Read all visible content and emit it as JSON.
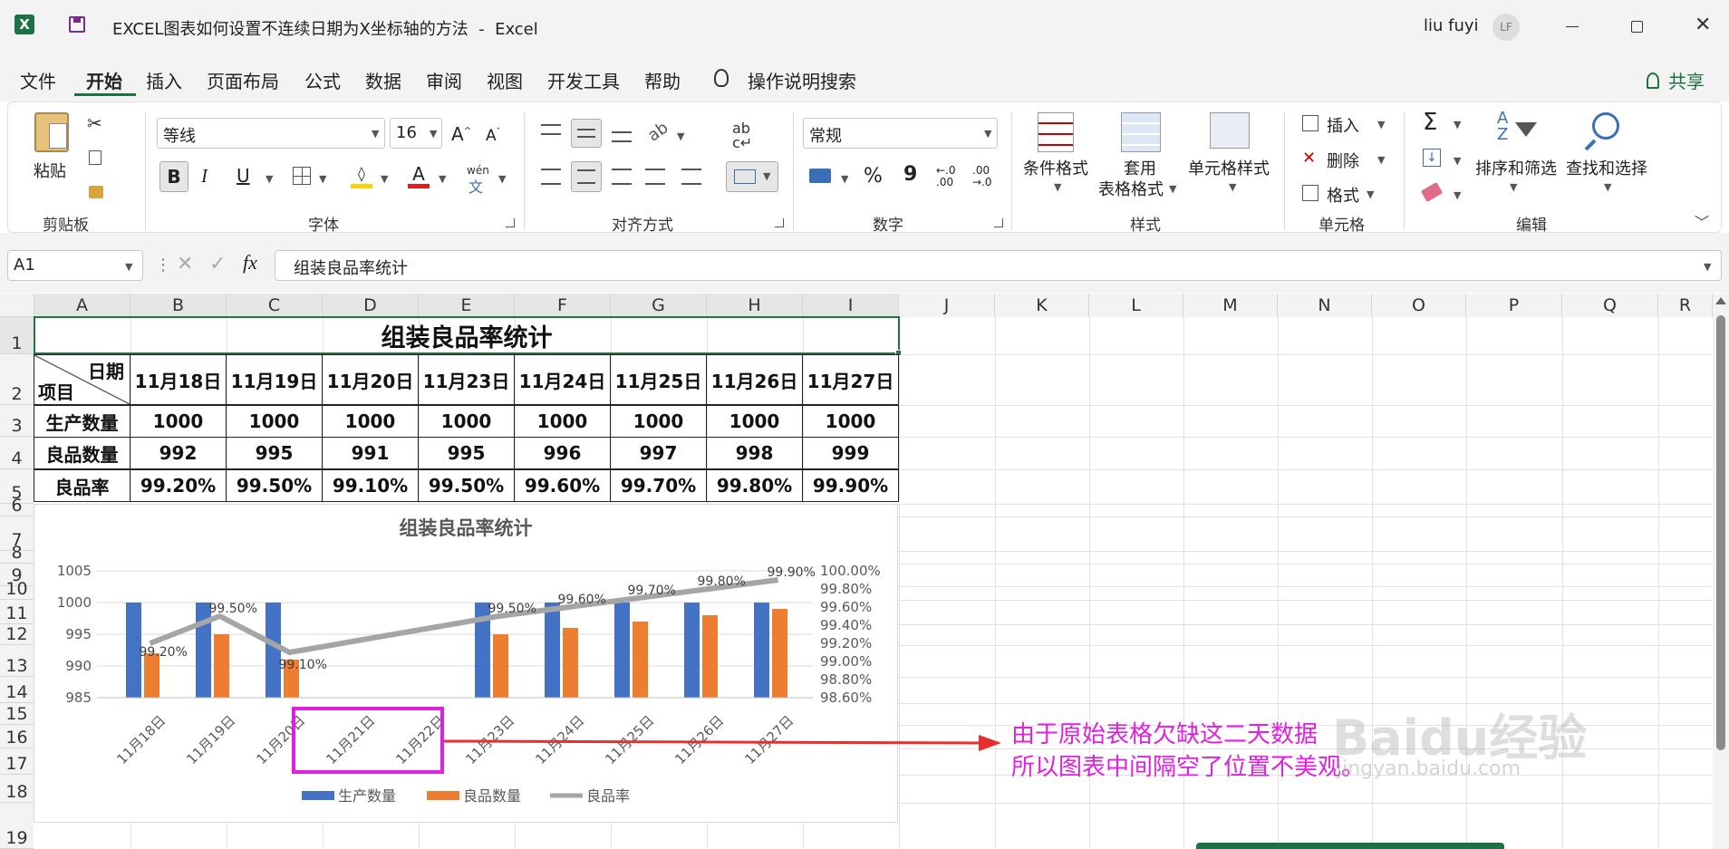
{
  "window": {
    "title": "EXCEL图表如何设置不连续日期为X坐标轴的方法  -  Excel",
    "user": "liu fuyi",
    "user_initials": "LF"
  },
  "menu_tabs": [
    "文件",
    "开始",
    "插入",
    "页面布局",
    "公式",
    "数据",
    "审阅",
    "视图",
    "开发工具",
    "帮助"
  ],
  "search_label": "操作说明搜索",
  "share_label": "共享",
  "ribbon": {
    "clipboard": {
      "paste": "粘贴",
      "group": "剪贴板"
    },
    "font": {
      "name": "等线",
      "size": "16",
      "bold": "B",
      "italic": "I",
      "underline": "U",
      "group": "字体",
      "wen": "wén"
    },
    "align": {
      "group": "对齐方式"
    },
    "number": {
      "format": "常规",
      "percent": "%",
      "comma": "9",
      "group": "数字"
    },
    "styles": {
      "cond": "条件格式",
      "table1": "套用",
      "table2": "表格格式",
      "cell": "单元格样式",
      "group": "样式"
    },
    "cells": {
      "insert": "插入",
      "delete": "删除",
      "format": "格式",
      "group": "单元格"
    },
    "edit": {
      "sort": "排序和筛选",
      "find": "查找和选择",
      "group": "编辑"
    }
  },
  "formula_bar": {
    "name_box": "A1",
    "fx": "fx",
    "value": "组装良品率统计"
  },
  "columns": [
    "A",
    "B",
    "C",
    "D",
    "E",
    "F",
    "G",
    "H",
    "I",
    "J",
    "K",
    "L",
    "M",
    "N",
    "O",
    "P",
    "Q",
    "R"
  ],
  "rows": [
    "1",
    "2",
    "3",
    "4",
    "5",
    "6",
    "7",
    "8",
    "9",
    "10",
    "11",
    "12",
    "13",
    "14",
    "15",
    "16",
    "17",
    "18",
    "19"
  ],
  "sheet": {
    "title": "组装良品率统计",
    "header_top": "日期",
    "header_left": "项目",
    "dates": [
      "11月18日",
      "11月19日",
      "11月20日",
      "11月23日",
      "11月24日",
      "11月25日",
      "11月26日",
      "11月27日"
    ],
    "row_labels": [
      "生产数量",
      "良品数量",
      "良品率"
    ],
    "production": [
      "1000",
      "1000",
      "1000",
      "1000",
      "1000",
      "1000",
      "1000",
      "1000"
    ],
    "good": [
      "992",
      "995",
      "991",
      "995",
      "996",
      "997",
      "998",
      "999"
    ],
    "rate": [
      "99.20%",
      "99.50%",
      "99.10%",
      "99.50%",
      "99.60%",
      "99.70%",
      "99.80%",
      "99.90%"
    ]
  },
  "chart_data": {
    "type": "bar",
    "title": "组装良品率统计",
    "categories": [
      "11月18日",
      "11月19日",
      "11月20日",
      "11月21日",
      "11月22日",
      "11月23日",
      "11月24日",
      "11月25日",
      "11月26日",
      "11月27日"
    ],
    "series": [
      {
        "name": "生产数量",
        "type": "bar",
        "axis": "left",
        "color": "#4472c4",
        "values": [
          1000,
          1000,
          1000,
          null,
          null,
          1000,
          1000,
          1000,
          1000,
          1000
        ]
      },
      {
        "name": "良品数量",
        "type": "bar",
        "axis": "left",
        "color": "#ed7d31",
        "values": [
          992,
          995,
          991,
          null,
          null,
          995,
          996,
          997,
          998,
          999
        ]
      },
      {
        "name": "良品率",
        "type": "line",
        "axis": "right",
        "color": "#a5a5a5",
        "values": [
          99.2,
          99.5,
          99.1,
          null,
          null,
          99.5,
          99.6,
          99.7,
          99.8,
          99.9
        ],
        "labels": [
          "99.20%",
          "99.50%",
          "99.10%",
          "",
          "",
          "99.50%",
          "99.60%",
          "99.70%",
          "99.80%",
          "99.90%"
        ]
      }
    ],
    "ylim": [
      985,
      1005
    ],
    "yticks": [
      "985",
      "990",
      "995",
      "1000",
      "1005"
    ],
    "y2lim": [
      98.6,
      100.0
    ],
    "y2ticks": [
      "98.60%",
      "98.80%",
      "99.00%",
      "99.20%",
      "99.40%",
      "99.60%",
      "99.80%",
      "100.00%"
    ],
    "legend": "bottom"
  },
  "annotation": {
    "line1": "由于原始表格欠缺这二天数据",
    "line2": "所以图表中间隔空了位置不美观。",
    "color": "#e020e0",
    "arrow_color": "#e53030"
  },
  "watermark": {
    "brand": "Baidu经验",
    "url": "jingyan.baidu.com"
  }
}
